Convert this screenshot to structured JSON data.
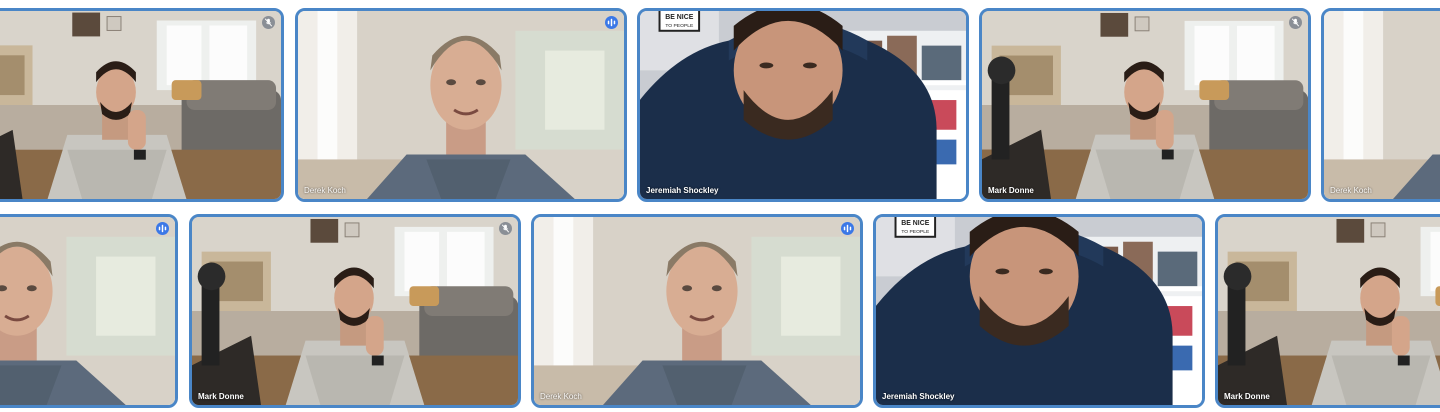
{
  "participants": [
    {
      "id": "mark",
      "name": "Mark Donne",
      "status": "muted",
      "status_icon": "mic-off-icon"
    },
    {
      "id": "derek",
      "name": "Derek Koch",
      "status": "speaking",
      "status_icon": "audio-wave-icon"
    },
    {
      "id": "jeremiah",
      "name": "Jeremiah Shockley",
      "status": "none"
    }
  ],
  "row1": {
    "tile2_name": "Derek Koch",
    "tile3_name": "Jeremiah Shockley",
    "tile4_name": "Mark Donne",
    "tile5_name": "Derek Koch"
  },
  "row2": {
    "tile2_name": "Mark Donne",
    "tile3_name": "Derek Koch",
    "tile4_name": "Jeremiah Shockley",
    "tile5_name": "Mark Donne"
  },
  "poster_text": "BE NICE TO PEOPLE",
  "colors": {
    "tile_border": "#4a86c7",
    "speaking_badge": "#3b78e7",
    "muted_badge": "#8a8f96"
  }
}
